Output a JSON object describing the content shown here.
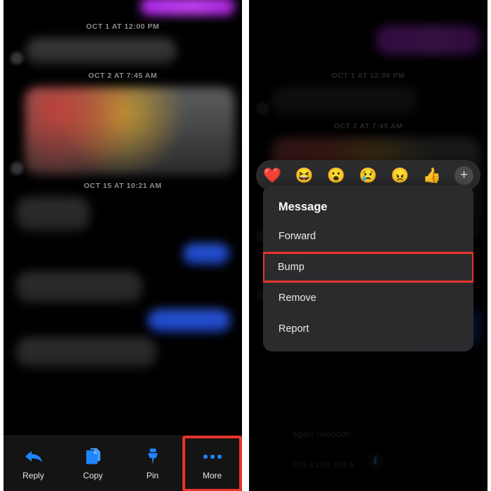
{
  "screen": {
    "title": "Messenger message long-press actions",
    "background": "#ffffff",
    "panel_background": "#000000",
    "accent_blue": "#1f86ff",
    "highlight_red": "#e8342c",
    "menu_background": "#2b2b2d"
  },
  "left_panel": {
    "name": "conversation-with-action-toolbar",
    "timestamps": [
      "OCT 1 AT 12:00 PM",
      "OCT 2 AT 7:45 AM",
      "OCT 15 AT 10:21 AM"
    ],
    "toolbar": {
      "items": [
        {
          "label": "Reply",
          "icon": "reply-arrow-icon",
          "highlighted": false
        },
        {
          "label": "Copy",
          "icon": "copy-documents-icon",
          "highlighted": false
        },
        {
          "label": "Pin",
          "icon": "pushpin-icon",
          "highlighted": false
        },
        {
          "label": "More",
          "icon": "three-dots-icon",
          "highlighted": true
        }
      ]
    }
  },
  "right_panel": {
    "name": "message-context-menu",
    "timestamps": [
      "OCT 1 AT 12:00 PM",
      "OCT 2 AT 7:45 AM"
    ],
    "reaction_bar": {
      "emojis": [
        {
          "name": "heart-reaction",
          "glyph": "❤️"
        },
        {
          "name": "laughing-reaction",
          "glyph": "😆"
        },
        {
          "name": "wow-reaction",
          "glyph": "😮"
        },
        {
          "name": "sad-reaction",
          "glyph": "😢"
        },
        {
          "name": "angry-reaction",
          "glyph": "😠"
        },
        {
          "name": "thumbs-up-reaction",
          "glyph": "👍"
        }
      ],
      "add_more_label": "+"
    },
    "context_menu": {
      "title": "Message",
      "items": [
        {
          "label": "Forward",
          "highlighted": false
        },
        {
          "label": "Bump",
          "highlighted": true
        },
        {
          "label": "Remove",
          "highlighted": false
        },
        {
          "label": "Report",
          "highlighted": false
        }
      ]
    },
    "background_messages": [
      "again ooooooh",
      "It is a cow not a"
    ],
    "scroll_down_glyph": "⬇"
  }
}
